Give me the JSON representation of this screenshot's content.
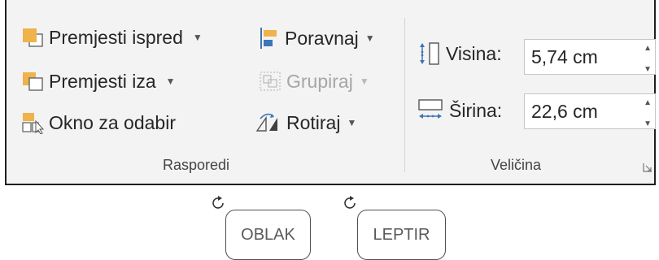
{
  "colors": {
    "ribbon_accent": "#b7472a",
    "icon_orange": "#f0b24a",
    "icon_blue": "#3f74b5"
  },
  "arrange": {
    "bring_forward": "Premjesti ispred",
    "send_backward": "Premjesti iza",
    "selection_pane": "Okno za odabir",
    "align": "Poravnaj",
    "group": "Grupiraj",
    "rotate": "Rotiraj",
    "group_label": "Rasporedi"
  },
  "size": {
    "height_label": "Visina:",
    "height_value": "5,74 cm",
    "width_label": "Širina:",
    "width_value": "22,6 cm",
    "group_label": "Veličina"
  },
  "shapes": [
    {
      "label": "OBLAK"
    },
    {
      "label": "LEPTIR"
    }
  ],
  "icons": {
    "bring_forward": "bring-forward-icon",
    "send_backward": "send-backward-icon",
    "selection_pane": "selection-pane-icon",
    "align": "align-icon",
    "group": "group-icon",
    "rotate": "rotate-icon",
    "height": "shape-height-icon",
    "width": "shape-width-icon",
    "dialog": "dialog-launcher-icon",
    "rotation_handle": "rotation-handle-icon"
  }
}
